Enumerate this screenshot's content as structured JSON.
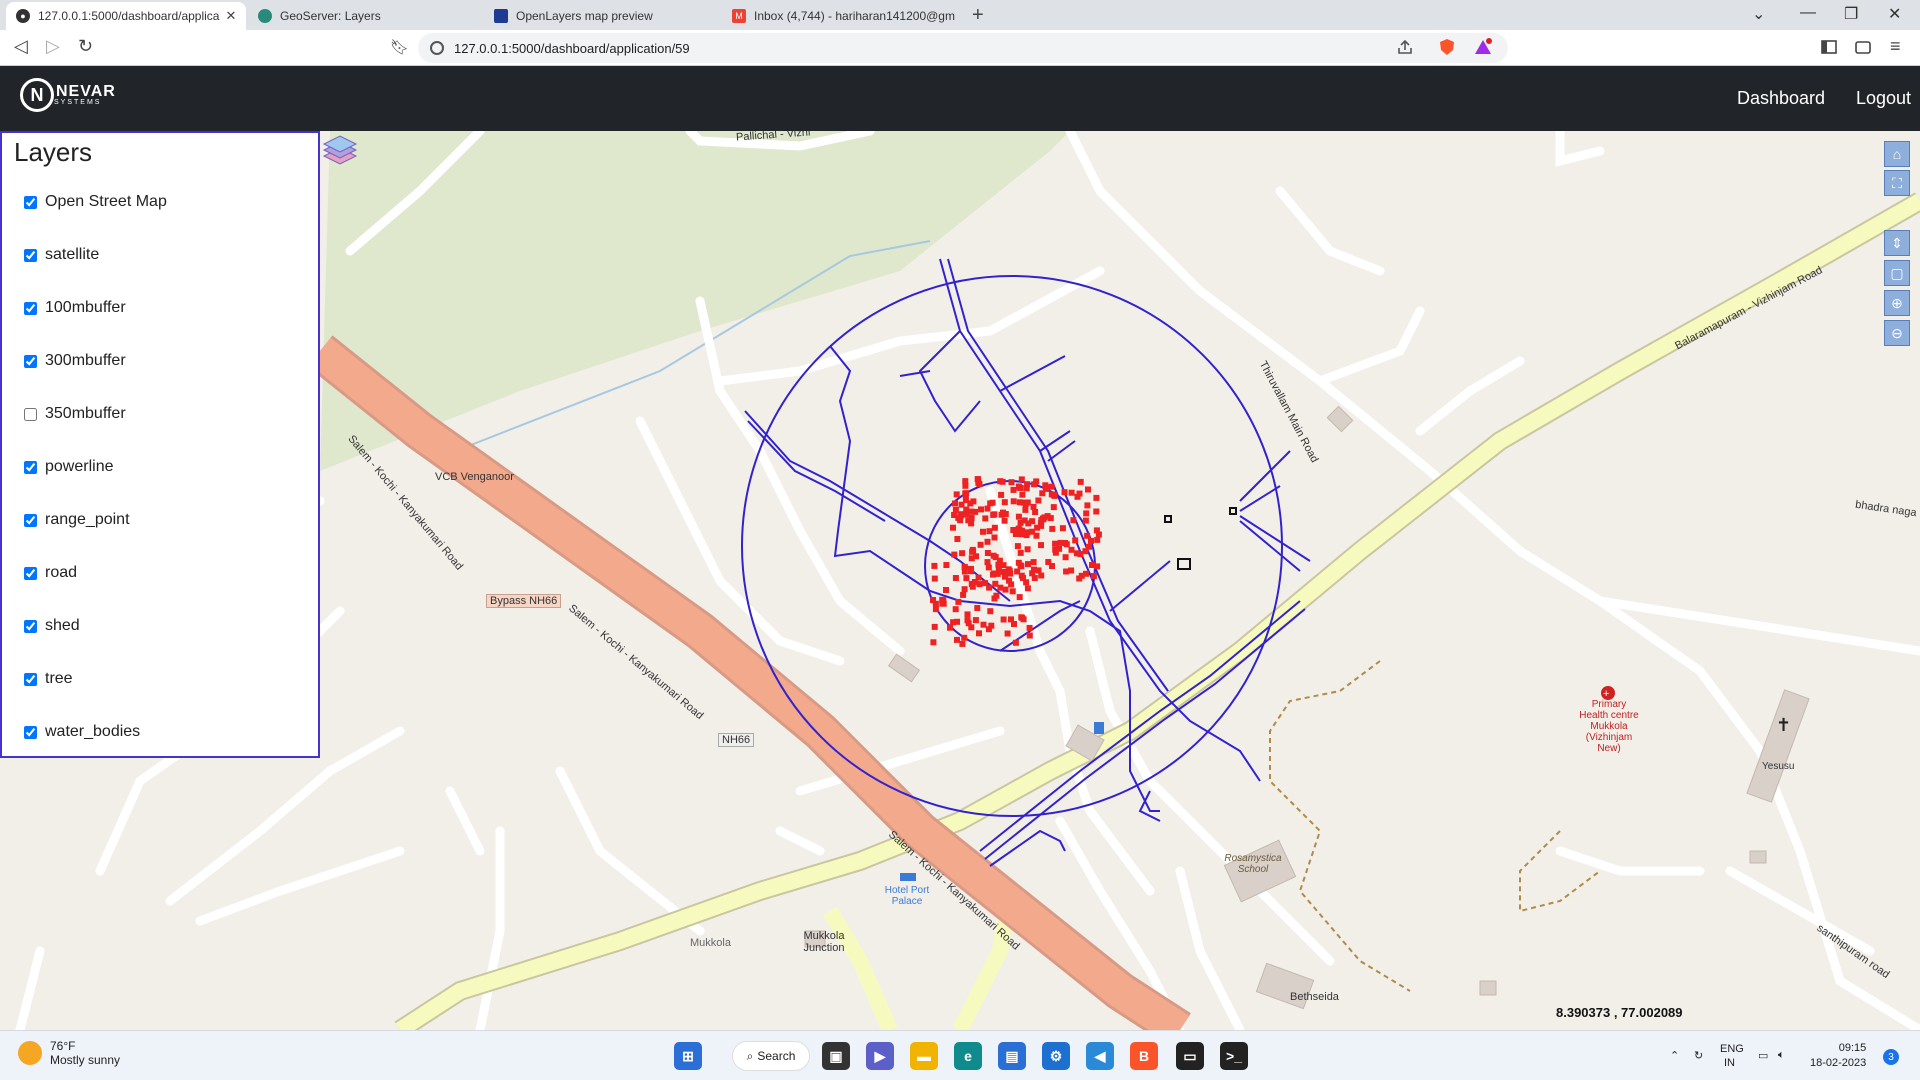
{
  "browser": {
    "tabs": [
      {
        "title": "127.0.0.1:5000/dashboard/applica",
        "active": true
      },
      {
        "title": "GeoServer: Layers",
        "active": false
      },
      {
        "title": "OpenLayers map preview",
        "active": false
      },
      {
        "title": "Inbox (4,744) - hariharan141200@gm",
        "active": false
      }
    ],
    "url": "127.0.0.1:5000/dashboard/application/59"
  },
  "app": {
    "brand": "NEVAR",
    "brand_sub": "SYSTEMS",
    "nav": [
      "Dashboard",
      "Logout"
    ]
  },
  "layers_panel": {
    "title": "Layers",
    "items": [
      {
        "label": "Open Street Map",
        "checked": true
      },
      {
        "label": "satellite",
        "checked": true
      },
      {
        "label": "100mbuffer",
        "checked": true
      },
      {
        "label": "300mbuffer",
        "checked": true
      },
      {
        "label": "350mbuffer",
        "checked": false
      },
      {
        "label": "powerline",
        "checked": true
      },
      {
        "label": "range_point",
        "checked": true
      },
      {
        "label": "road",
        "checked": true
      },
      {
        "label": "shed",
        "checked": true
      },
      {
        "label": "tree",
        "checked": true
      },
      {
        "label": "water_bodies",
        "checked": true
      }
    ]
  },
  "map": {
    "labels": {
      "pallichal": "Pallichal - Vizhi",
      "vcb": "VCB Venganoor",
      "salem1": "Salem - Kochi - Kanyakumari Road",
      "bypass": "Bypass NH66",
      "salem2": "Salem - Kochi - Kanyakumari Road",
      "nh66": "NH66",
      "salem3": "Salem - Kochi - Kanyakumari Road",
      "thiruvallam": "Thiruvallam Main Road",
      "balaramapuram": "Balaramapuram - Vizhinjam Road",
      "bhadra": "bhadra naga",
      "phc": "Primary Health centre Mukkola (Vizhinjam New)",
      "yesusu": "Yesusu",
      "rosamystica": "Rosamystica School",
      "hotel": "Hotel Port Palace",
      "mukkola": "Mukkola",
      "junction": "Mukkola Junction",
      "bethseida": "Bethseida",
      "santhipuram": "santhipuram road"
    },
    "coordinates": "8.390373 , 77.002089",
    "colors": {
      "buffer": "#3322cc",
      "tree": "#ee2222",
      "trunk": "#f3a98c"
    }
  },
  "taskbar": {
    "temp": "76°F",
    "weather": "Mostly sunny",
    "search": "Search",
    "lang": "ENG",
    "region": "IN",
    "time": "09:15",
    "date": "18-02-2023",
    "notifications": "3"
  }
}
